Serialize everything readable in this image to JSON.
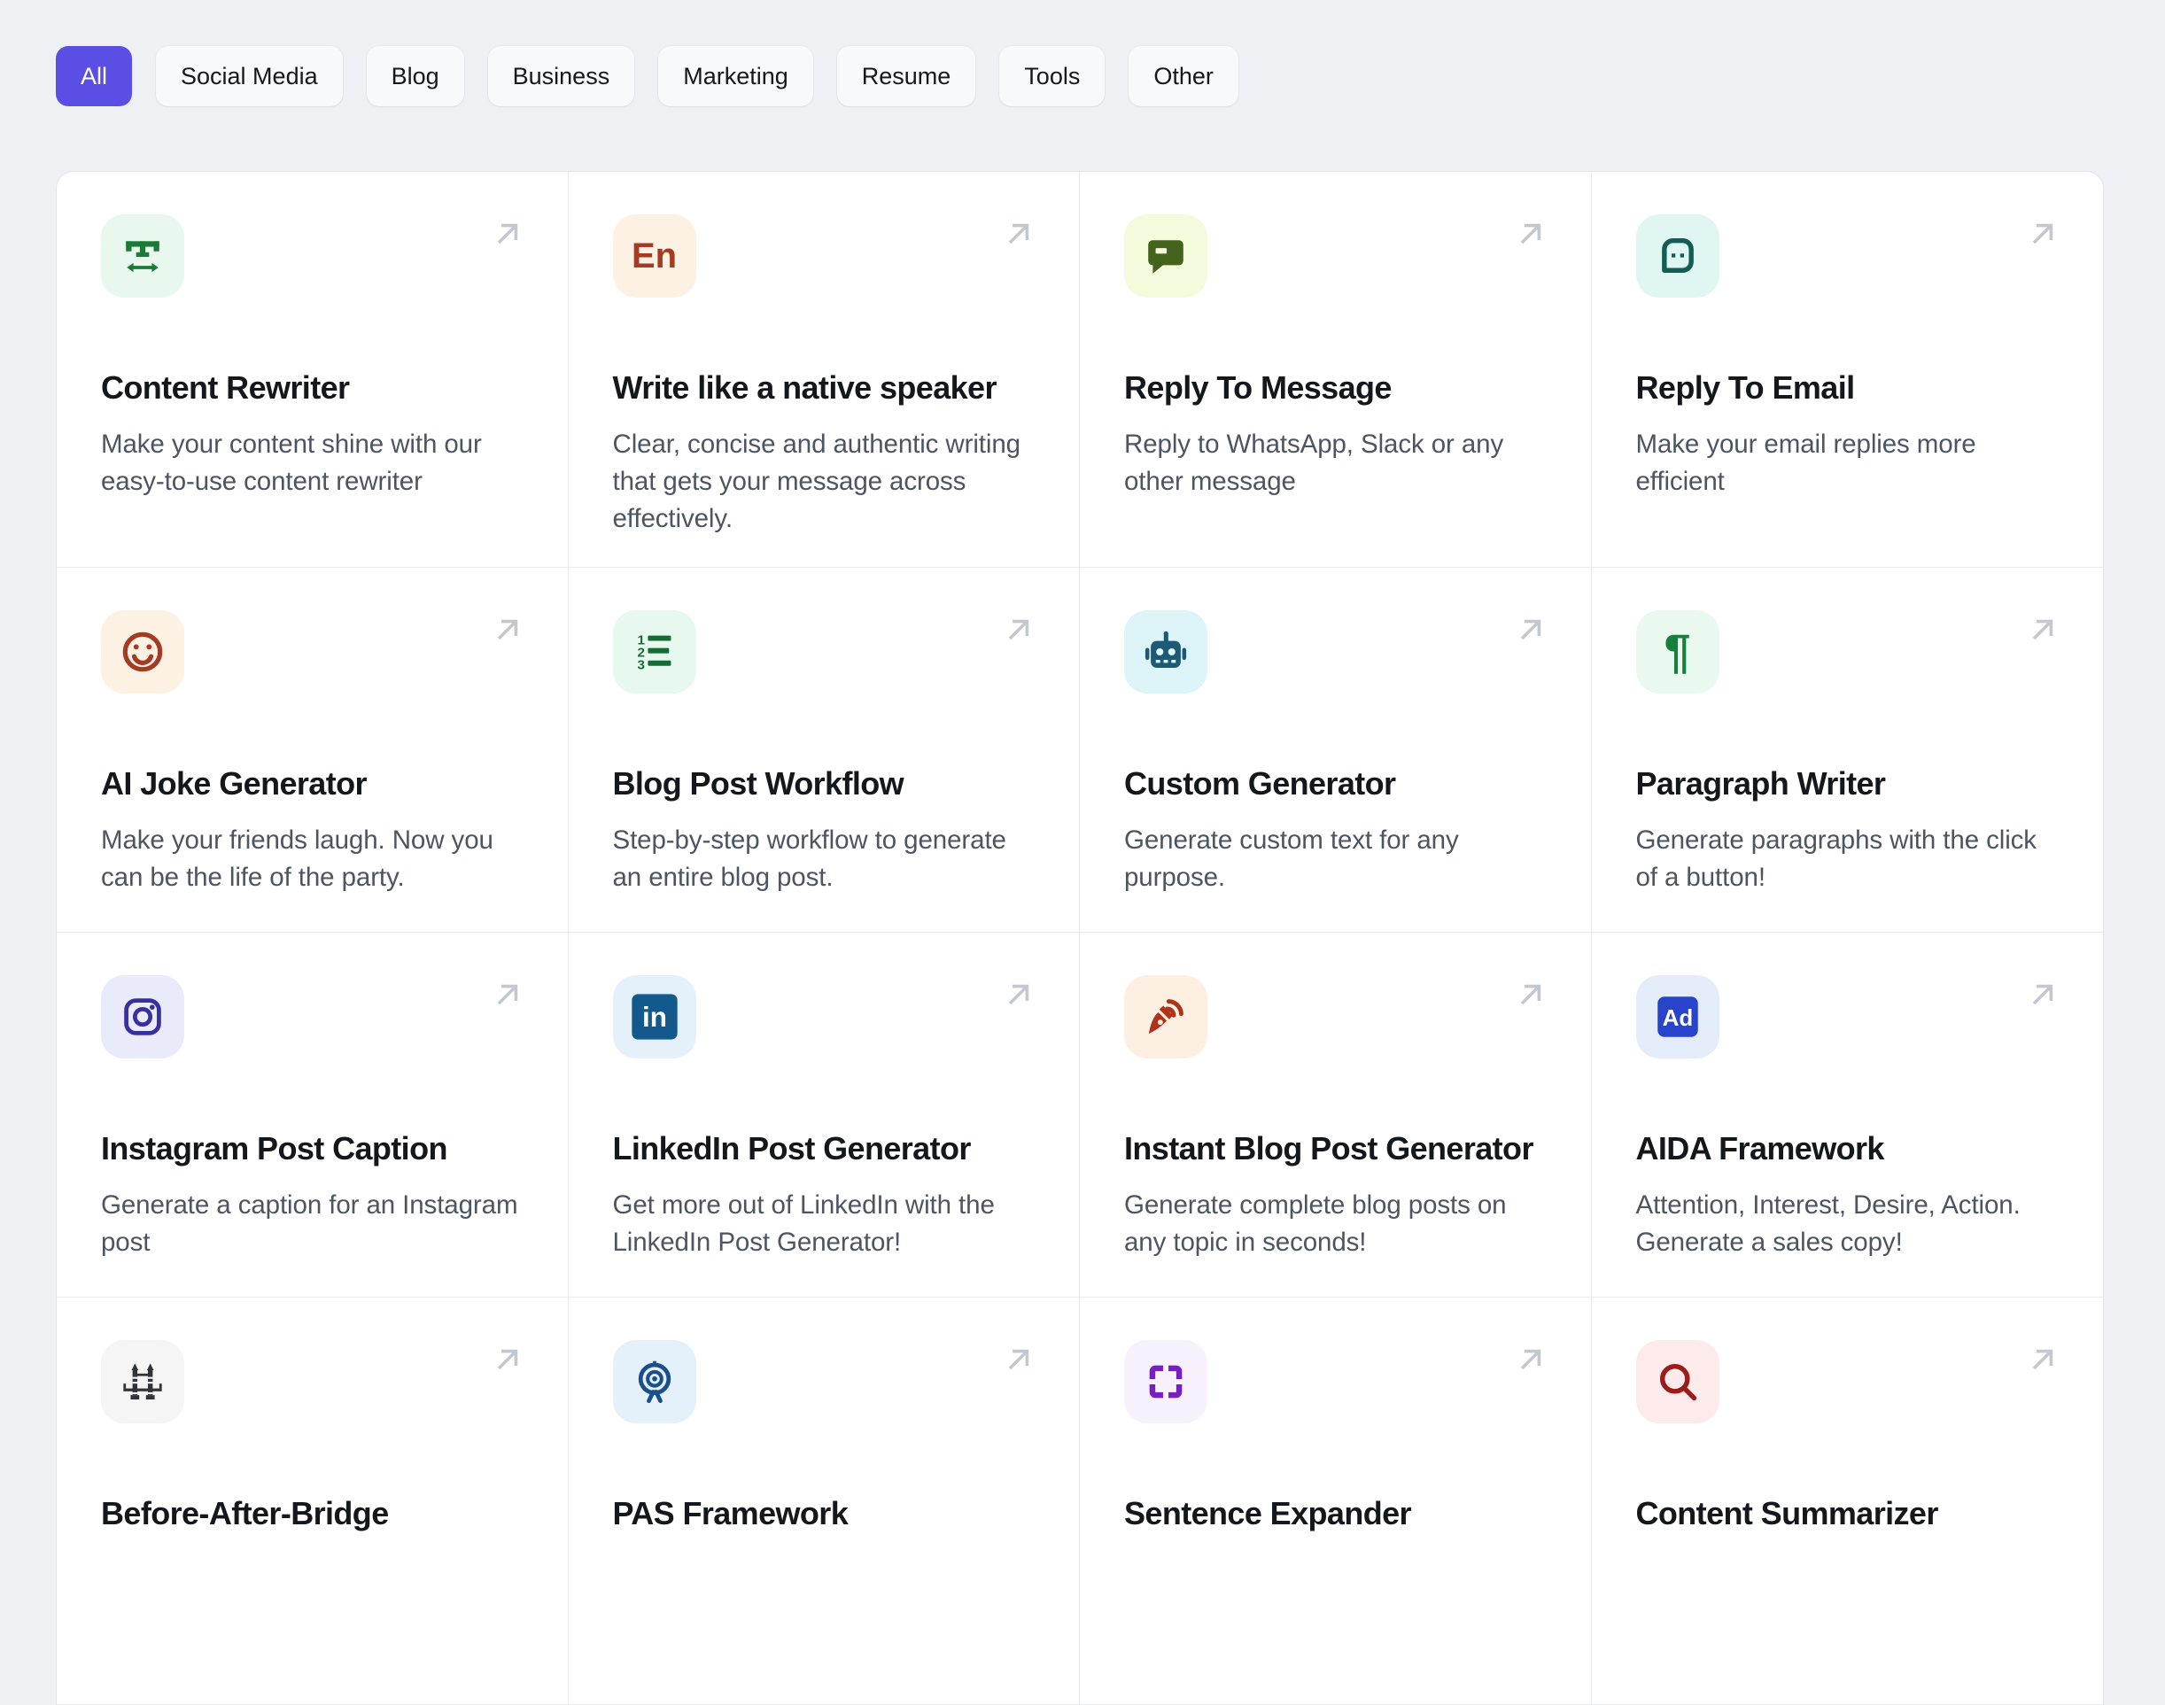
{
  "page": {
    "background": "#eef0f3",
    "card_background": "#ffffff",
    "border_color": "#e9eaee"
  },
  "filters": {
    "active_color": "#5b4ee5",
    "items": [
      {
        "label": "All",
        "active": true
      },
      {
        "label": "Social Media",
        "active": false
      },
      {
        "label": "Blog",
        "active": false
      },
      {
        "label": "Business",
        "active": false
      },
      {
        "label": "Marketing",
        "active": false
      },
      {
        "label": "Resume",
        "active": false
      },
      {
        "label": "Tools",
        "active": false
      },
      {
        "label": "Other",
        "active": false
      }
    ]
  },
  "cards": [
    {
      "title": "Content Rewriter",
      "description": "Make your content shine with our easy-to-use content rewriter",
      "icon": "text-width-icon",
      "icon_color": "#1a7a36",
      "icon_bg": "#e8f8ee"
    },
    {
      "title": "Write like a native speaker",
      "description": "Clear, concise and authentic writing that gets your message across effectively.",
      "icon": "english-language-icon",
      "icon_text": "En",
      "icon_color": "#a43b23",
      "icon_bg": "#fdf1e3"
    },
    {
      "title": "Reply To Message",
      "description": "Reply to WhatsApp, Slack or any other message",
      "icon": "chat-bubble-icon",
      "icon_color": "#44631c",
      "icon_bg": "#f4fbdc"
    },
    {
      "title": "Reply To Email",
      "description": "Make your email replies more efficient",
      "icon": "chat-dots-icon",
      "icon_color": "#135e54",
      "icon_bg": "#e0f6f2"
    },
    {
      "title": "AI Joke Generator",
      "description": "Make your friends laugh. Now you can be the life of the party.",
      "icon": "smiley-icon",
      "icon_color": "#a43b23",
      "icon_bg": "#fdf1e4"
    },
    {
      "title": "Blog Post Workflow",
      "description": "Step-by-step workflow to generate an entire blog post.",
      "icon": "numbered-list-icon",
      "icon_color": "#176b35",
      "icon_bg": "#e7f8ee"
    },
    {
      "title": "Custom Generator",
      "description": "Generate custom text for any purpose.",
      "icon": "robot-icon",
      "icon_color": "#1d5a74",
      "icon_bg": "#ddf5f9"
    },
    {
      "title": "Paragraph Writer",
      "description": "Generate paragraphs with the click of a button!",
      "icon": "pilcrow-icon",
      "icon_text": "¶",
      "icon_color": "#15803c",
      "icon_bg": "#e9f9ef"
    },
    {
      "title": "Instagram Post Caption",
      "description": "Generate a caption for an Instagram post",
      "icon": "instagram-icon",
      "icon_color": "#38309e",
      "icon_bg": "#e9ebfb"
    },
    {
      "title": "LinkedIn Post Generator",
      "description": "Get more out of LinkedIn with the LinkedIn Post Generator!",
      "icon": "linkedin-icon",
      "icon_text": "in",
      "icon_color": "#14598c",
      "icon_bg": "#e4f0fa"
    },
    {
      "title": "Instant Blog Post Generator",
      "description": "Generate complete blog posts on any topic in seconds!",
      "icon": "pen-broadcast-icon",
      "icon_color": "#b03218",
      "icon_bg": "#fdf0e3"
    },
    {
      "title": "AIDA Framework",
      "description": "Attention, Interest, Desire, Action. Generate a sales copy!",
      "icon": "ad-badge-icon",
      "icon_text": "Ad",
      "icon_color": "#2744cb",
      "icon_bg": "#e4ecf9"
    },
    {
      "title": "Before-After-Bridge",
      "description": "",
      "icon": "bridge-icon",
      "icon_color": "#303338",
      "icon_bg": "#f5f5f6"
    },
    {
      "title": "PAS Framework",
      "description": "",
      "icon": "target-icon",
      "icon_color": "#1a508a",
      "icon_bg": "#e4f0fa"
    },
    {
      "title": "Sentence Expander",
      "description": "",
      "icon": "expand-icon",
      "icon_color": "#7a1fbf",
      "icon_bg": "#f6f1fb"
    },
    {
      "title": "Content Summarizer",
      "description": "",
      "icon": "magnifier-icon",
      "icon_color": "#9b1c1c",
      "icon_bg": "#fdeaea"
    }
  ]
}
